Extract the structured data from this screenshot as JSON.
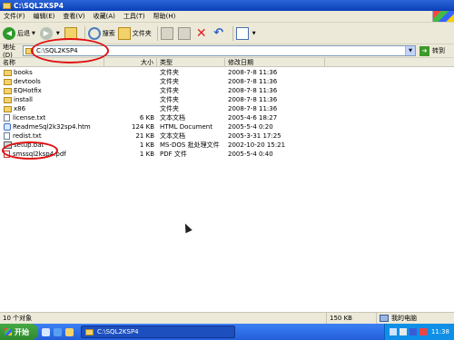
{
  "window": {
    "title": "C:\\SQL2KSP4"
  },
  "menu": [
    "文件(F)",
    "编辑(E)",
    "查看(V)",
    "收藏(A)",
    "工具(T)",
    "帮助(H)"
  ],
  "toolbar": {
    "back": "后退",
    "search": "搜索",
    "folders": "文件夹"
  },
  "address": {
    "label": "地址(D)",
    "value": "C:\\SQL2KSP4",
    "go": "转到"
  },
  "columns": {
    "name": "名称",
    "size": "大小",
    "type": "类型",
    "date": "修改日期"
  },
  "files": [
    {
      "name": "books",
      "size": "",
      "type": "文件夹",
      "date": "2008-7-8 11:36",
      "icon": "folder-icon"
    },
    {
      "name": "devtools",
      "size": "",
      "type": "文件夹",
      "date": "2008-7-8 11:36",
      "icon": "folder-icon"
    },
    {
      "name": "EQHotfix",
      "size": "",
      "type": "文件夹",
      "date": "2008-7-8 11:36",
      "icon": "folder-icon"
    },
    {
      "name": "install",
      "size": "",
      "type": "文件夹",
      "date": "2008-7-8 11:36",
      "icon": "folder-icon"
    },
    {
      "name": "x86",
      "size": "",
      "type": "文件夹",
      "date": "2008-7-8 11:36",
      "icon": "folder-icon"
    },
    {
      "name": "license.txt",
      "size": "6 KB",
      "type": "文本文档",
      "date": "2005-4-6 18:27",
      "icon": "text-file-icon"
    },
    {
      "name": "ReadmeSql2k32sp4.htm",
      "size": "124 KB",
      "type": "HTML Document",
      "date": "2005-5-4 0:20",
      "icon": "html-file-icon"
    },
    {
      "name": "redist.txt",
      "size": "21 KB",
      "type": "文本文档",
      "date": "2005-3-31 17:25",
      "icon": "text-file-icon"
    },
    {
      "name": "setup.bat",
      "size": "1 KB",
      "type": "MS-DOS 批处理文件",
      "date": "2002-10-20 15:21",
      "icon": "batch-file-icon"
    },
    {
      "name": "smssql2ksp4.pdf",
      "size": "1 KB",
      "type": "PDF 文件",
      "date": "2005-5-4 0:40",
      "icon": "pdf-file-icon"
    }
  ],
  "status": {
    "count": "10 个对象",
    "size": "150 KB",
    "location": "我的电脑"
  },
  "taskbar": {
    "start": "开始",
    "task": "C:\\SQL2KSP4",
    "clock": "11:38"
  },
  "colors": {
    "title_blue": "#0a3fb8",
    "taskbar_blue": "#245edb",
    "start_green": "#2f8a2d",
    "annotation_red": "#e01010"
  }
}
